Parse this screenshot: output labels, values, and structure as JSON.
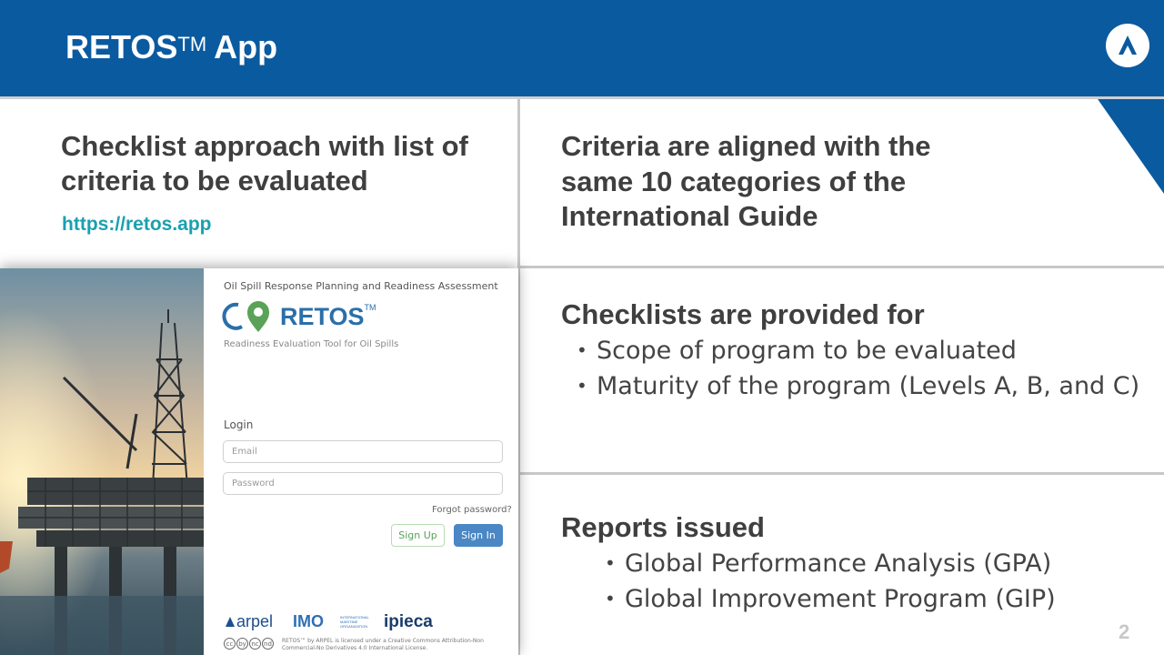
{
  "header": {
    "title": "RETOS",
    "trademark": "TM",
    "title_suffix": "App",
    "brand_color": "#0a5aa0"
  },
  "logo_icon": "company-logo-icon",
  "left_top": {
    "heading": "Checklist approach with list of criteria to be evaluated",
    "link": "https://retos.app"
  },
  "right_cells": {
    "criteria": "Criteria are aligned with the same 10 categories of the International Guide",
    "checklists": {
      "heading": "Checklists are provided for",
      "items": [
        "Scope of program to be evaluated",
        "Maturity of the program (Levels A, B, and C)"
      ]
    },
    "reports": {
      "heading": "Reports issued",
      "items": [
        "Global Performance Analysis (GPA)",
        "Global Improvement Program (GIP)"
      ]
    }
  },
  "app_screenshot": {
    "tagline": "Oil Spill Response Planning and Readiness Assessment",
    "brand": "RETOS",
    "brand_tm": "TM",
    "subtitle": "Readiness Evaluation Tool for Oil Spills",
    "login_label": "Login",
    "email_placeholder": "Email",
    "password_placeholder": "Password",
    "forgot": "Forgot password?",
    "signup": "Sign Up",
    "signin": "Sign In",
    "partners": {
      "arpel": "arpel",
      "imo": "IMO",
      "imo_small": "INTERNATIONAL MARITIME ORGANIZATION",
      "ipieca": "ipieca"
    },
    "cc_icons": [
      "cc",
      "by",
      "nc",
      "nd"
    ],
    "license": "RETOS™ by ARPEL is licensed under a Creative Commons Attribution-Non Commercial-No Derivatives 4.0 International License."
  },
  "page_number": "2",
  "colors": {
    "accent_teal": "#1aa0b0",
    "text_dark": "#3f3f3f",
    "divider": "#c8c8c8",
    "signin_blue": "#4a87c4"
  }
}
